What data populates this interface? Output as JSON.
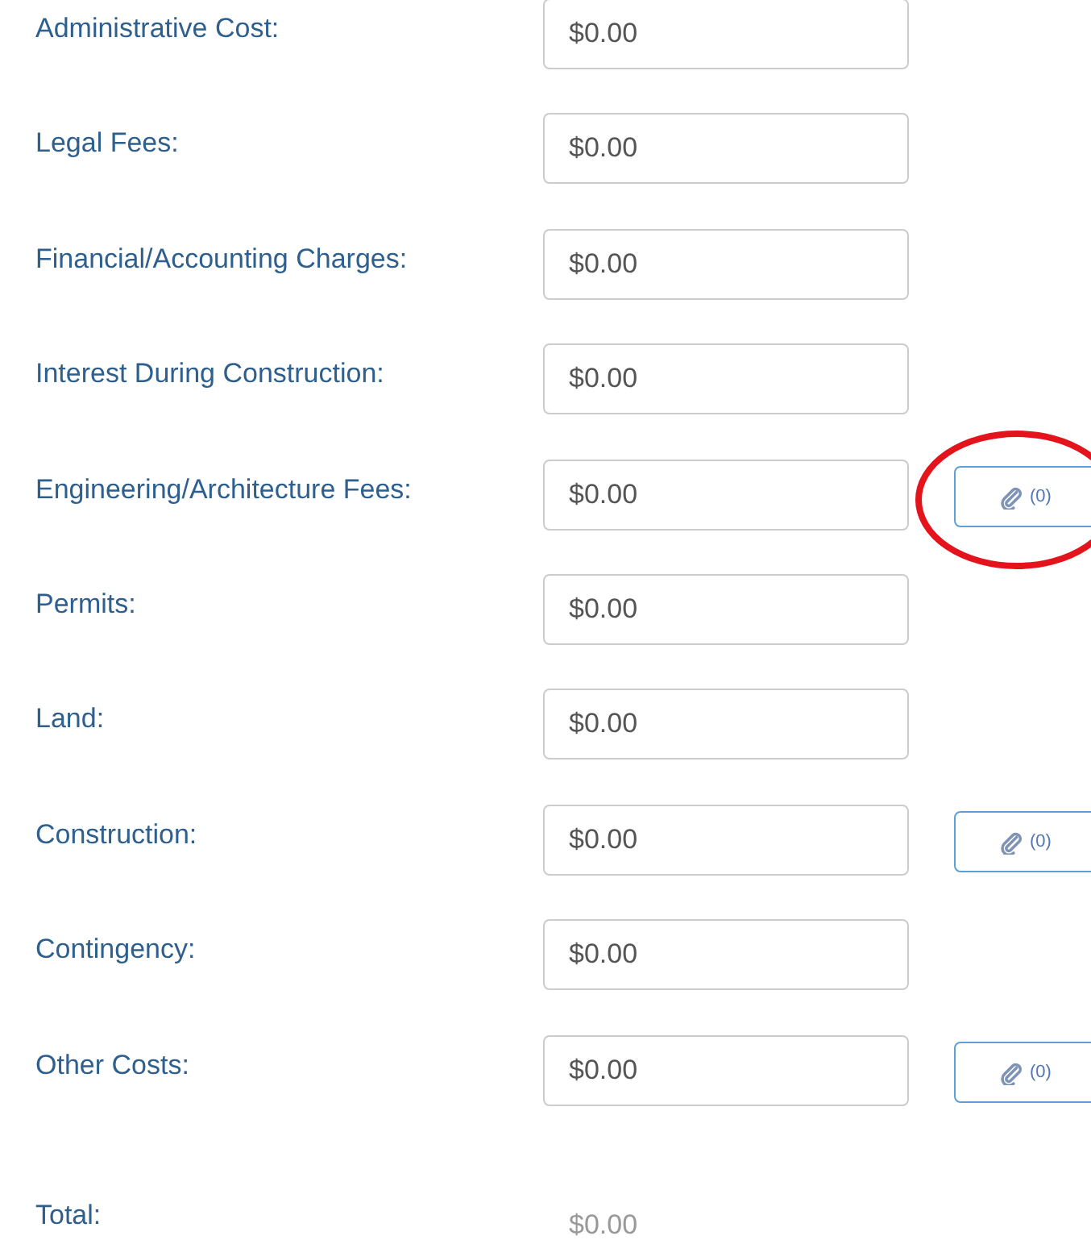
{
  "rows": [
    {
      "label": "Administrative Cost:",
      "value": "$0.00",
      "highlighted": false
    },
    {
      "label": "Legal Fees:",
      "value": "$0.00",
      "highlighted": false
    },
    {
      "label": "Financial/Accounting Charges:",
      "value": "$0.00",
      "highlighted": false
    },
    {
      "label": "Interest During Construction:",
      "value": "$0.00",
      "highlighted": false
    },
    {
      "label": "Engineering/Architecture Fees:",
      "value": "$0.00",
      "attachments": "(0)",
      "highlighted": true
    },
    {
      "label": "Permits:",
      "value": "$0.00",
      "highlighted": false
    },
    {
      "label": "Land:",
      "value": "$0.00",
      "highlighted": false
    },
    {
      "label": "Construction:",
      "value": "$0.00",
      "attachments": "(0)",
      "highlighted": false
    },
    {
      "label": "Contingency:",
      "value": "$0.00",
      "highlighted": false
    },
    {
      "label": "Other Costs:",
      "value": "$0.00",
      "attachments": "(0)",
      "highlighted": false
    }
  ],
  "total": {
    "label": "Total:",
    "value": "$0.00"
  }
}
